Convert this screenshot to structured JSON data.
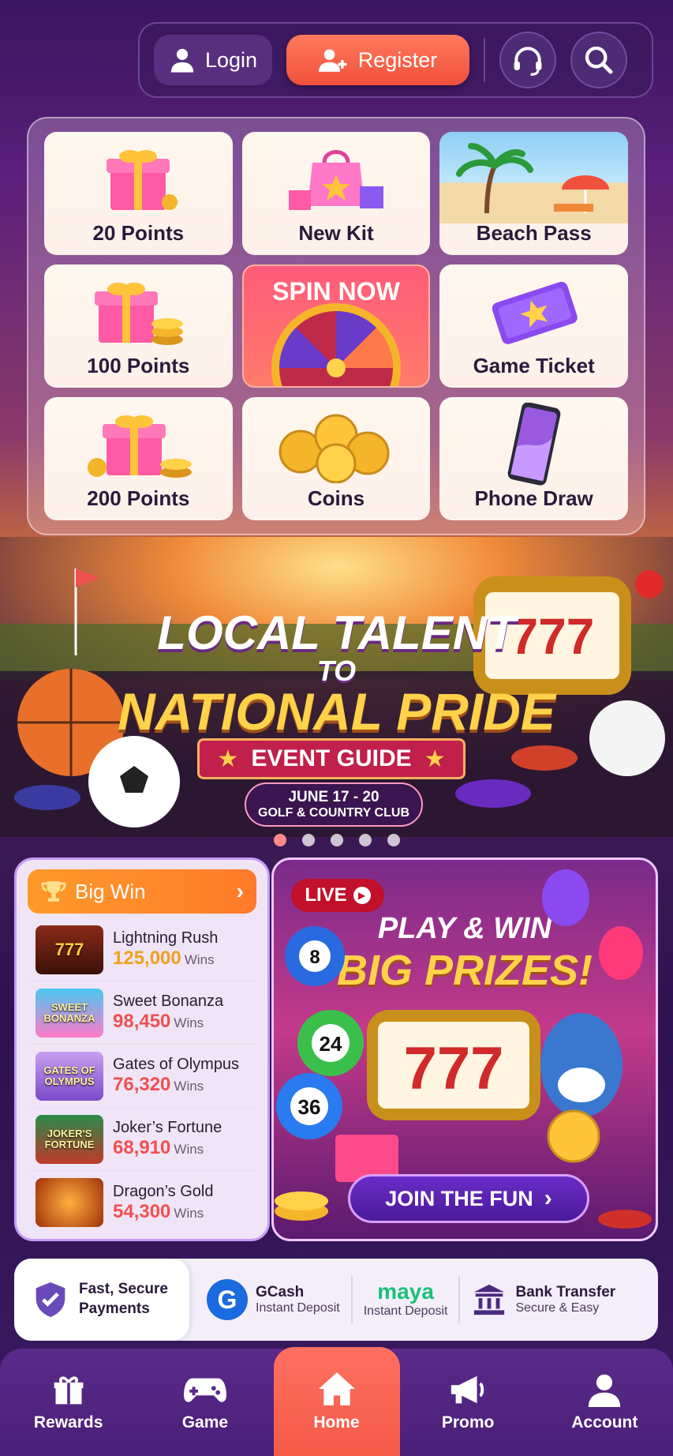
{
  "header": {
    "login_label": "Login",
    "register_label": "Register"
  },
  "rewards": [
    {
      "label": "20 Points"
    },
    {
      "label": "New Kit"
    },
    {
      "label": "Beach Pass"
    },
    {
      "label": "100 Points"
    },
    {
      "label": "SPIN NOW"
    },
    {
      "label": "Game Ticket"
    },
    {
      "label": "200 Points"
    },
    {
      "label": "Coins"
    },
    {
      "label": "Phone Draw"
    }
  ],
  "banner": {
    "line1": "LOCAL TALENT",
    "line2": "TO",
    "line3": "NATIONAL PRIDE",
    "ribbon": "EVENT GUIDE",
    "date": "JUNE 17 - 20",
    "venue": "GOLF & COUNTRY CLUB",
    "slot_digits": "777",
    "carousel_pages": 5,
    "active_page": 2
  },
  "big_win": {
    "title": "Big Win",
    "items": [
      {
        "name": "Lightning Rush",
        "value": "125,000",
        "unit": "Wins",
        "thumb": "777"
      },
      {
        "name": "Sweet Bonanza",
        "value": "98,450",
        "unit": "Wins",
        "thumb": "SWEET BONANZA"
      },
      {
        "name": "Gates of Olympus",
        "value": "76,320",
        "unit": "Wins",
        "thumb": "GATES OF OLYMPUS"
      },
      {
        "name": "Joker’s Fortune",
        "value": "68,910",
        "unit": "Wins",
        "thumb": "JOKER'S FORTUNE"
      },
      {
        "name": "Dragon’s Gold",
        "value": "54,300",
        "unit": "Wins",
        "thumb": ""
      }
    ]
  },
  "promo": {
    "live_label": "LIVE",
    "title_line1": "PLAY & WIN",
    "title_line2": "BIG PRIZES!",
    "ball_numbers": [
      "8",
      "24",
      "36"
    ],
    "slot_digits": "777",
    "cta_label": "JOIN THE FUN"
  },
  "payments": {
    "secure_line1": "Fast, Secure",
    "secure_line2": "Payments",
    "methods": [
      {
        "name": "GCash",
        "sub": "Instant Deposit"
      },
      {
        "name": "maya",
        "sub": "Instant Deposit"
      },
      {
        "name": "Bank Transfer",
        "sub": "Secure & Easy"
      }
    ]
  },
  "nav": [
    {
      "label": "Rewards"
    },
    {
      "label": "Game"
    },
    {
      "label": "Home"
    },
    {
      "label": "Promo"
    },
    {
      "label": "Account"
    }
  ],
  "colors": {
    "accent": "#f55a48",
    "gold": "#ffd24a",
    "purple": "#4a1f78"
  }
}
